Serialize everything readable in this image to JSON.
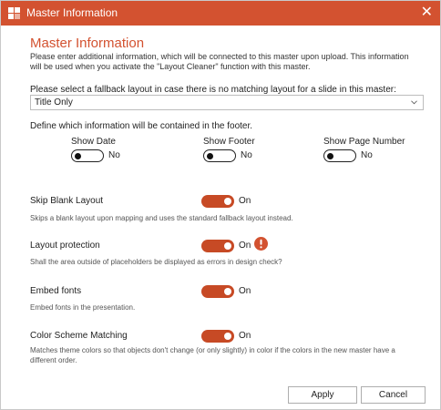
{
  "window": {
    "title": "Master Information",
    "close_glyph": "✕",
    "icon": "app-icon",
    "accent_color": "#d35230"
  },
  "header": {
    "heading": "Master Information",
    "intro": "Please enter additional information, which will be connected to this master upon upload. This information will be used when you activate the \"Layout Cleaner\" function with this master."
  },
  "fallback": {
    "label": "Please select a fallback layout in case there is no matching layout for a slide in this master:",
    "selected": "Title Only"
  },
  "footer": {
    "label": "Define which information will be contained in the footer.",
    "options": [
      {
        "label": "Show Date",
        "state": "No",
        "on": false
      },
      {
        "label": "Show Footer",
        "state": "No",
        "on": false
      },
      {
        "label": "Show Page Number",
        "state": "No",
        "on": false
      }
    ]
  },
  "settings": [
    {
      "title": "Skip Blank Layout",
      "state": "On",
      "on": true,
      "description": "Skips a blank layout upon mapping and uses the standard fallback layout instead."
    },
    {
      "title": "Layout protection",
      "state": "On",
      "on": true,
      "warning_icon": "exclamation-icon",
      "description": "Shall the area outside of placeholders be displayed as errors in design check?"
    },
    {
      "title": "Embed fonts",
      "state": "On",
      "on": true,
      "description": "Embed fonts in the presentation."
    },
    {
      "title": "Color Scheme Matching",
      "state": "On",
      "on": true,
      "description": "Matches theme colors so that objects don't change (or only slightly) in color if the colors in the new master have a different order."
    }
  ],
  "buttons": {
    "apply": "Apply",
    "cancel": "Cancel"
  }
}
